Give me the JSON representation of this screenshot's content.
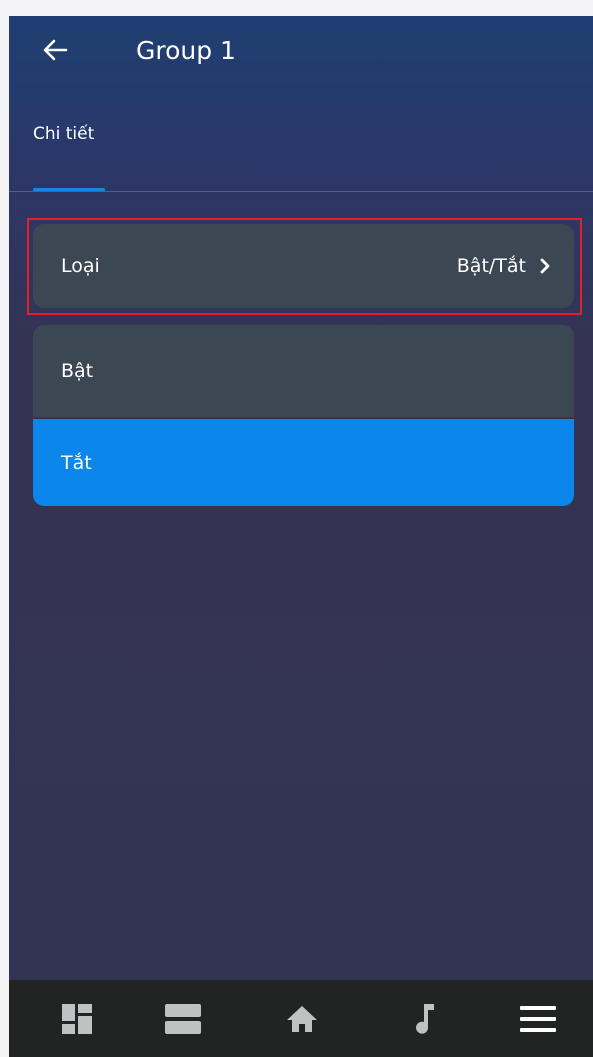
{
  "header": {
    "title": "Group 1",
    "back_icon": "arrow-left-icon"
  },
  "tabs": [
    {
      "label": "Chi tiết",
      "active": true
    }
  ],
  "type_row": {
    "label": "Loại",
    "value": "Bật/Tắt",
    "icon": "chevron-right-icon"
  },
  "options": [
    {
      "label": "Bật",
      "selected": false
    },
    {
      "label": "Tắt",
      "selected": true
    }
  ],
  "bottom_nav": [
    {
      "icon": "dashboard-icon"
    },
    {
      "icon": "rooms-icon"
    },
    {
      "icon": "home-icon"
    },
    {
      "icon": "music-icon"
    },
    {
      "icon": "menu-icon"
    }
  ],
  "colors": {
    "accent": "#0b86ea",
    "highlight_border": "#e0202c",
    "row_background": "#3b4753",
    "nav_background": "#222323",
    "nav_icon": "#bfc1c3"
  }
}
